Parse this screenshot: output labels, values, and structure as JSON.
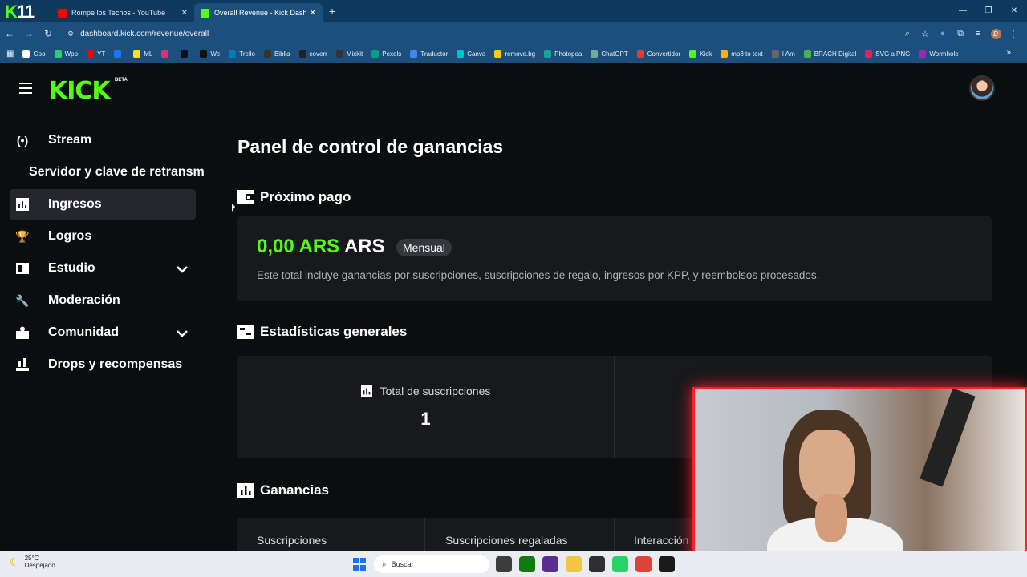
{
  "browser": {
    "logo_text": "11",
    "tabs": [
      {
        "title": "Rompe los Techos - YouTube",
        "color": "#ff0000"
      },
      {
        "title": "Overall Revenue - Kick Dashboard",
        "color": "#53fc18"
      }
    ],
    "new_tab": "+",
    "url": "dashboard.kick.com/revenue/overall",
    "bookmarks": [
      {
        "label": "Goo",
        "color": "#ffffff"
      },
      {
        "label": "Wpp",
        "color": "#25d366"
      },
      {
        "label": "YT",
        "color": "#ff0000"
      },
      {
        "label": "",
        "color": "#1877f2"
      },
      {
        "label": "ML",
        "color": "#ffe600"
      },
      {
        "label": "",
        "color": "#e1306c"
      },
      {
        "label": "",
        "color": "#111111"
      },
      {
        "label": "We",
        "color": "#111111"
      },
      {
        "label": "Trello",
        "color": "#0079bf"
      },
      {
        "label": "Biblia",
        "color": "#333333"
      },
      {
        "label": "coverr",
        "color": "#222222"
      },
      {
        "label": "Mixkit",
        "color": "#333333"
      },
      {
        "label": "Pexels",
        "color": "#05a081"
      },
      {
        "label": "Traductor",
        "color": "#4285f4"
      },
      {
        "label": "Canva",
        "color": "#00c4cc"
      },
      {
        "label": "remove.bg",
        "color": "#ffcc00"
      },
      {
        "label": "Photopea",
        "color": "#18a497"
      },
      {
        "label": "ChatGPT",
        "color": "#74aa9c"
      },
      {
        "label": "Convertidor",
        "color": "#e53935"
      },
      {
        "label": "Kick",
        "color": "#53fc18"
      },
      {
        "label": "mp3 to text",
        "color": "#ffb300"
      },
      {
        "label": "I Am",
        "color": "#666666"
      },
      {
        "label": "BRACH Digital",
        "color": "#4caf50"
      },
      {
        "label": "SVG a PNG",
        "color": "#e91e63"
      },
      {
        "label": "Wormhole",
        "color": "#9c27b0"
      }
    ]
  },
  "kick": {
    "logo": "KICK",
    "beta": "BETA",
    "sidebar": [
      {
        "label": "Stream",
        "icon": "broadcast-icon"
      },
      {
        "label": "Servidor y clave de retransm",
        "icon": ""
      },
      {
        "label": "Ingresos",
        "icon": "chart-icon",
        "active": true
      },
      {
        "label": "Logros",
        "icon": "trophy-icon"
      },
      {
        "label": "Estudio",
        "icon": "studio-icon",
        "chevron": true
      },
      {
        "label": "Moderación",
        "icon": "wrench-icon"
      },
      {
        "label": "Comunidad",
        "icon": "community-icon",
        "chevron": true
      },
      {
        "label": "Drops y recompensas",
        "icon": "drops-icon"
      }
    ],
    "page_title": "Panel de control de ganancias",
    "next_payment": {
      "title": "Próximo pago",
      "amount": "0,00 ARS",
      "currency": "ARS",
      "badge": "Mensual",
      "description": "Este total incluye ganancias por suscripciones, suscripciones de regalo, ingresos por KPP, y reembolsos procesados."
    },
    "stats": {
      "title": "Estadísticas generales",
      "items": [
        {
          "label": "Total de suscripciones",
          "value": "1"
        }
      ]
    },
    "earnings": {
      "title": "Ganancias",
      "columns": [
        "Suscripciones",
        "Suscripciones regaladas",
        "Interacción"
      ]
    }
  },
  "taskbar": {
    "temperature": "25°C",
    "weather": "Despejado",
    "search_placeholder": "Buscar"
  }
}
